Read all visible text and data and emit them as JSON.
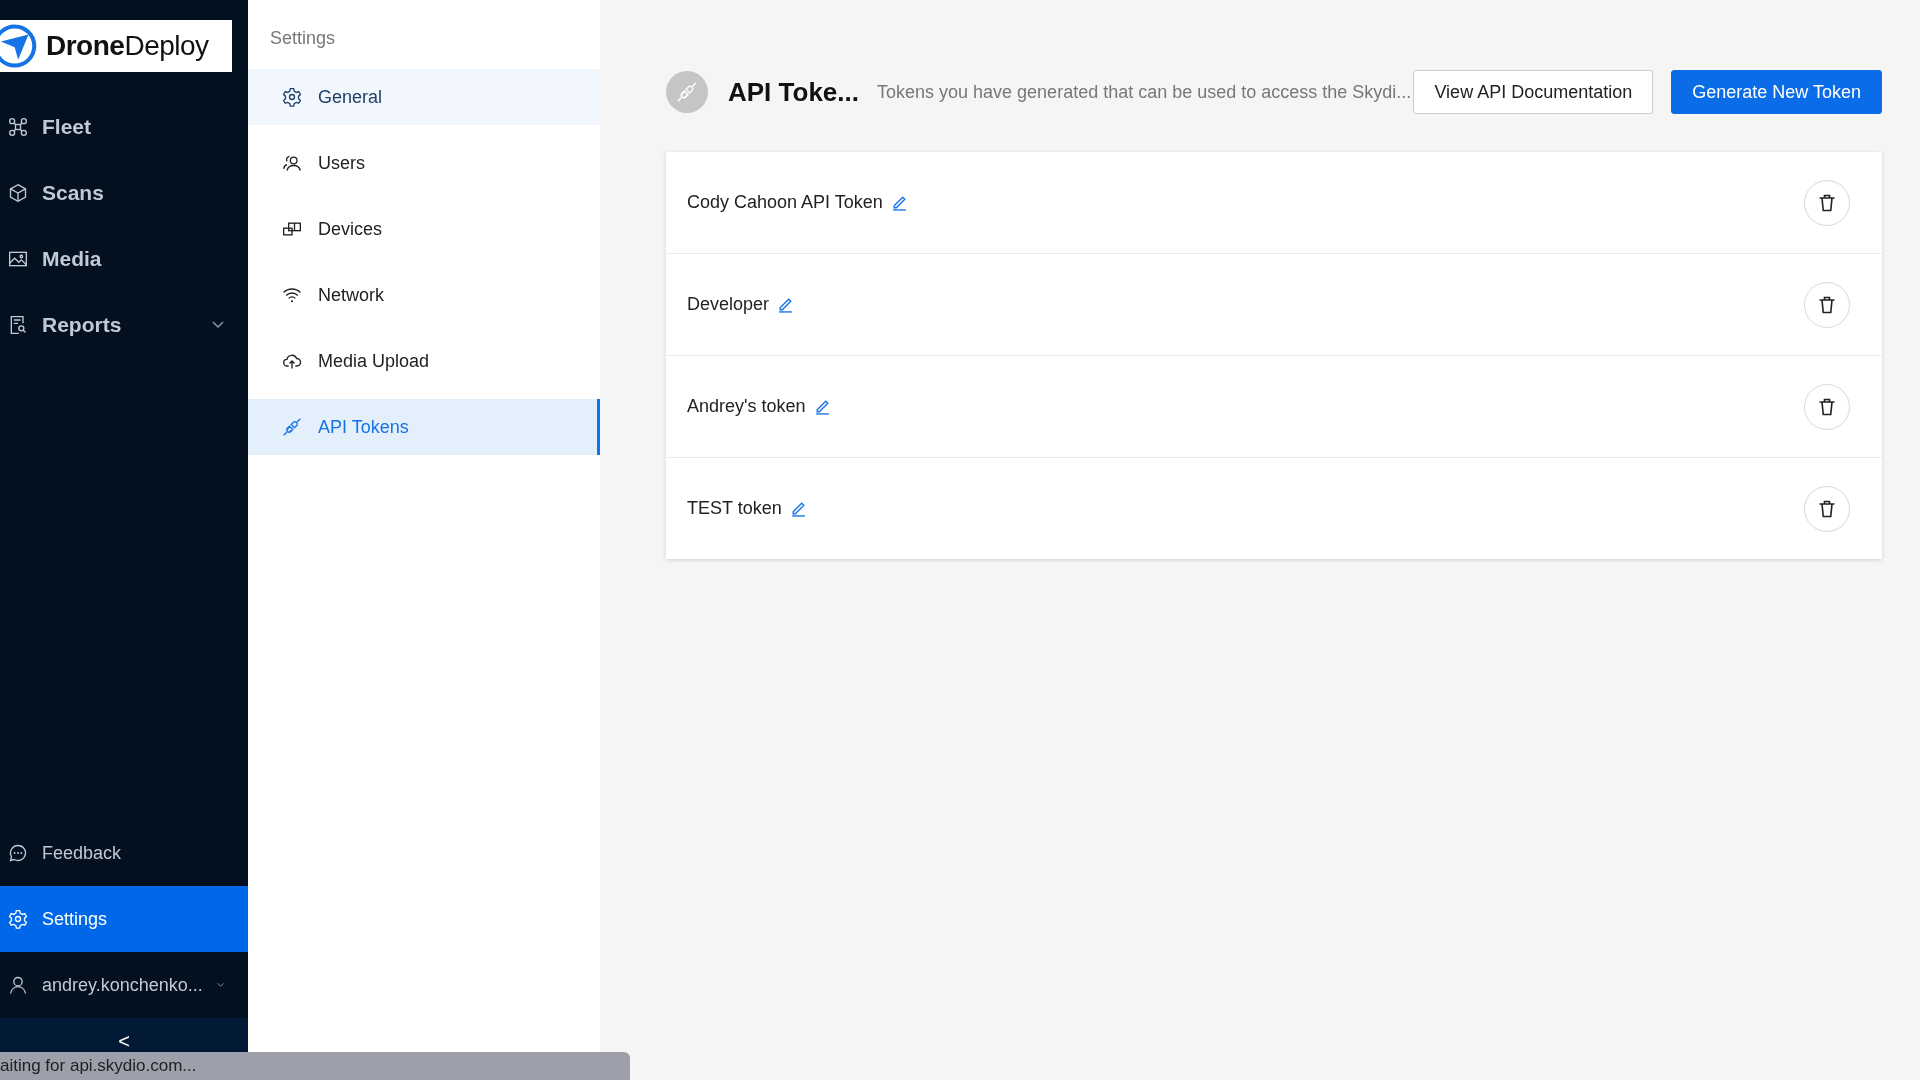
{
  "logo": {
    "text_bold": "Drone",
    "text_regular": "Deploy"
  },
  "nav": {
    "items": [
      {
        "label": "Fleet",
        "kind": "drone",
        "selected": false,
        "expandable": false
      },
      {
        "label": "Scans",
        "kind": "cube",
        "selected": false,
        "expandable": false
      },
      {
        "label": "Media",
        "kind": "image",
        "selected": false,
        "expandable": false
      },
      {
        "label": "Reports",
        "kind": "report",
        "selected": false,
        "expandable": true
      }
    ],
    "bottom_items": [
      {
        "label": "Feedback",
        "kind": "chat",
        "selected": false,
        "expandable": false
      },
      {
        "label": "Settings",
        "kind": "gear",
        "selected": true,
        "expandable": false
      },
      {
        "label": "andrey.konchenko...",
        "kind": "user",
        "selected": false,
        "expandable": true
      }
    ],
    "collapse": "<"
  },
  "settings_menu": {
    "title": "Settings",
    "items": [
      {
        "label": "General",
        "kind": "gear",
        "selected": false,
        "hovered": true
      },
      {
        "label": "Users",
        "kind": "users",
        "selected": false,
        "hovered": false
      },
      {
        "label": "Devices",
        "kind": "devices",
        "selected": false,
        "hovered": false
      },
      {
        "label": "Network",
        "kind": "wifi",
        "selected": false,
        "hovered": false
      },
      {
        "label": "Media Upload",
        "kind": "cloud",
        "selected": false,
        "hovered": false
      },
      {
        "label": "API Tokens",
        "kind": "plug",
        "selected": true,
        "hovered": false
      }
    ]
  },
  "header": {
    "title": "API Toke...",
    "subtitle": "Tokens you have generated that can be used to access the Skydi...",
    "buttons": [
      {
        "label": "View API Documentation",
        "kind": "secondary"
      },
      {
        "label": "Generate New Token",
        "kind": "primary"
      }
    ]
  },
  "tokens": [
    {
      "name": "Cody Cahoon API Token"
    },
    {
      "name": "Developer"
    },
    {
      "name": "Andrey's token"
    },
    {
      "name": "TEST token"
    }
  ],
  "status_bar": "aiting for api.skydio.com..."
}
